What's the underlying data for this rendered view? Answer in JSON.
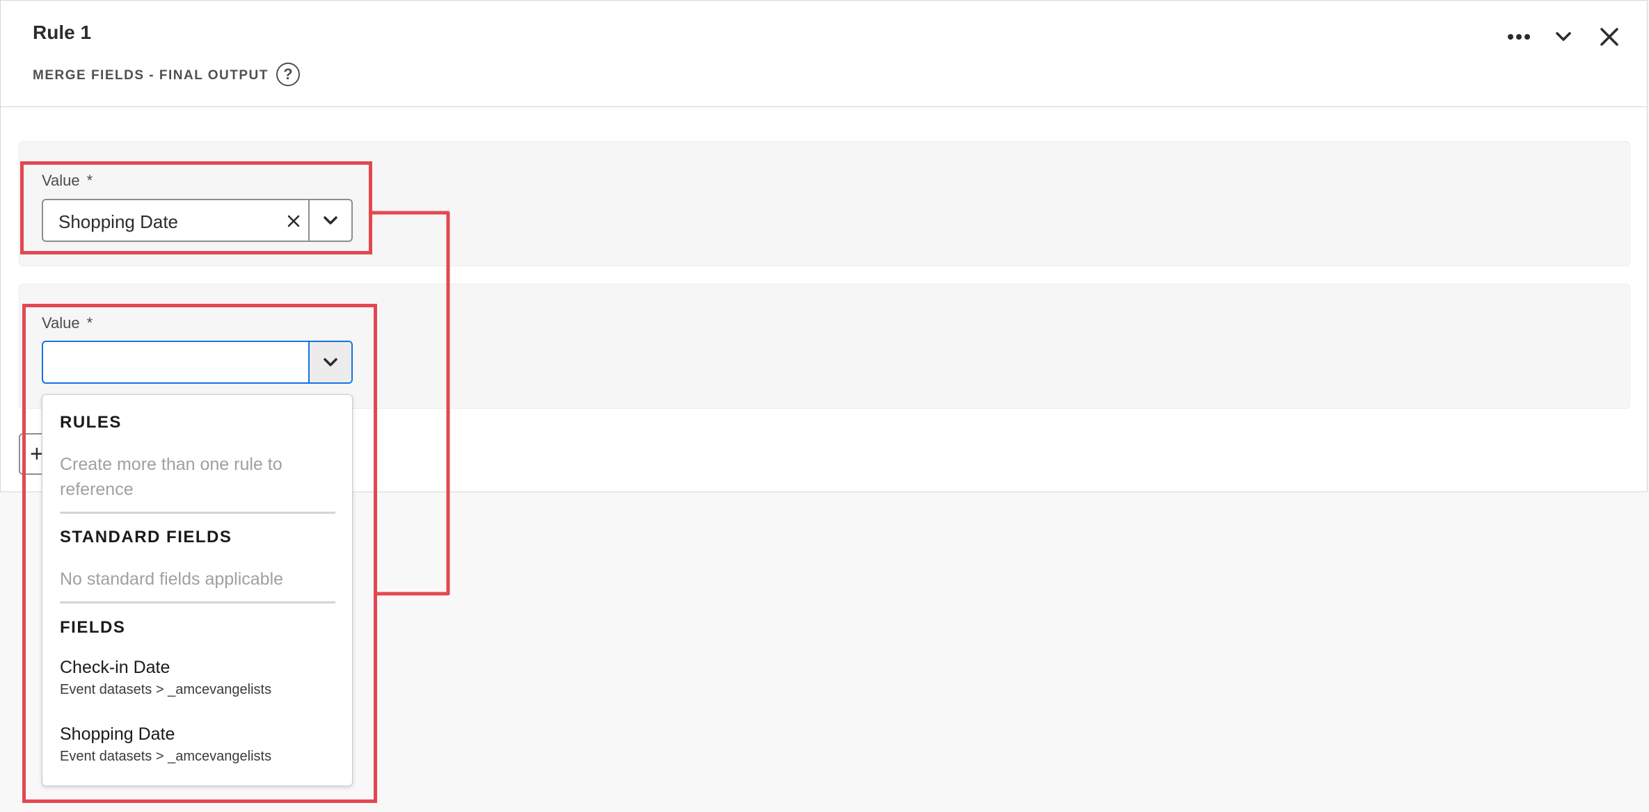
{
  "panel": {
    "title": "Rule 1",
    "subtitle": "MERGE FIELDS - FINAL OUTPUT",
    "help_icon": "question-circle-icon",
    "actions": {
      "more_icon": "more-horizontal-icon",
      "collapse_icon": "chevron-down-icon",
      "close_icon": "close-icon"
    }
  },
  "rows": [
    {
      "label": "Value",
      "required_mark": "*",
      "value": "Shopping Date"
    },
    {
      "label": "Value",
      "required_mark": "*",
      "value": "",
      "focused": true
    }
  ],
  "add_button": {
    "label": "+"
  },
  "dropdown": {
    "sections": {
      "rules": {
        "heading": "RULES",
        "empty_text": "Create more than one rule to reference"
      },
      "standard_fields": {
        "heading": "STANDARD FIELDS",
        "empty_text": "No standard fields applicable"
      },
      "fields": {
        "heading": "FIELDS",
        "options": [
          {
            "title": "Check-in Date",
            "path": "Event datasets > _amcevangelists"
          },
          {
            "title": "Shopping Date",
            "path": "Event datasets > _amcevangelists"
          }
        ]
      }
    }
  },
  "colors": {
    "highlight": "#e34850",
    "focus": "#1473e6"
  }
}
